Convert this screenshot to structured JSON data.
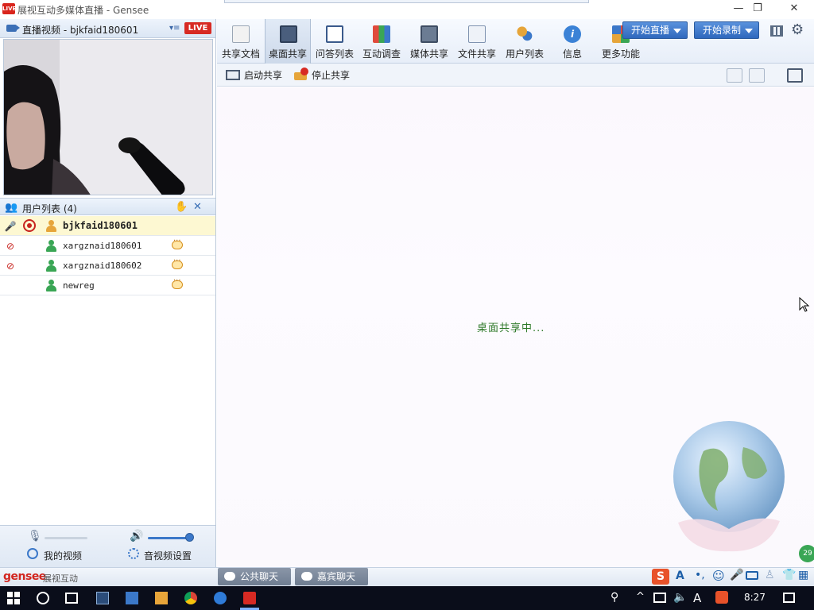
{
  "window": {
    "title": "展视互动多媒体直播 - Gensee",
    "app_icon_text": "LIVE",
    "minimize": "—",
    "restore": "❐",
    "close": "✕"
  },
  "left": {
    "video_header": "直播视频 - bjkfaid180601",
    "live_badge": "LIVE",
    "users_header": "用户列表 (4)",
    "users": [
      {
        "name": "bjkfaid180601"
      },
      {
        "name": "xargznaid180601"
      },
      {
        "name": "xargznaid180602"
      },
      {
        "name": "newreg"
      }
    ],
    "my_video": "我的视频",
    "av_settings": "音视频设置",
    "mic_level": 0.0,
    "speaker_level": 1.0
  },
  "toolbar": {
    "items": [
      {
        "label": "共享文档",
        "icon": "document-icon"
      },
      {
        "label": "桌面共享",
        "icon": "desktop-share-icon"
      },
      {
        "label": "问答列表",
        "icon": "qa-icon"
      },
      {
        "label": "互动调查",
        "icon": "survey-icon"
      },
      {
        "label": "媒体共享",
        "icon": "media-icon"
      },
      {
        "label": "文件共享",
        "icon": "file-share-icon"
      },
      {
        "label": "用户列表",
        "icon": "users-icon"
      },
      {
        "label": "信息",
        "icon": "info-icon"
      },
      {
        "label": "更多功能",
        "icon": "more-icon"
      }
    ],
    "start_live": "开始直播",
    "start_record": "开始录制"
  },
  "subbar": {
    "start_share": "启动共享",
    "stop_share": "停止共享"
  },
  "main": {
    "status": "桌面共享中..."
  },
  "bottom": {
    "brand": "gensee",
    "brand_cn": "展视互动",
    "public_chat": "公共聊天",
    "guest_chat": "嘉宾聊天",
    "badge": "29"
  },
  "taskbar": {
    "time": "8:27",
    "ime": "A"
  }
}
